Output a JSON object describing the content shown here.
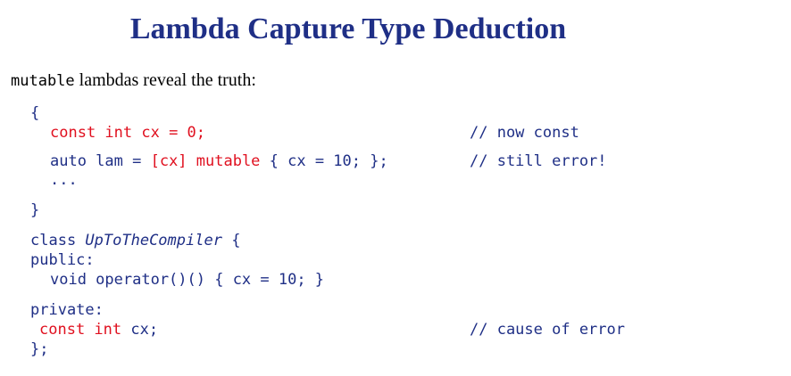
{
  "slide": {
    "title": "Lambda Capture Type Deduction",
    "intro_keyword": "mutable",
    "intro_text": " lambdas reveal the truth:"
  },
  "code": {
    "l1": "{",
    "l2_kw": "const int",
    "l2_rest": " cx = 0;",
    "l2_comment": "// now const",
    "l3_a": "auto lam = ",
    "l3_b": "[cx] mutable",
    "l3_c": " { cx = 10; };",
    "l3_comment": "// still error!",
    "l4": "...",
    "l5": "}",
    "l6_a": "class ",
    "l6_b": "UpToTheCompiler",
    "l6_c": " {",
    "l7": "public:",
    "l8": "void operator()() { cx = 10; }",
    "l9": "private:",
    "l10_kw": "const int",
    "l10_rest": " cx;",
    "l10_comment": "// cause of error",
    "l11": "};"
  },
  "colors": {
    "title": "#1f2f86",
    "code_blue": "#1f2f86",
    "code_red": "#e0101f"
  }
}
